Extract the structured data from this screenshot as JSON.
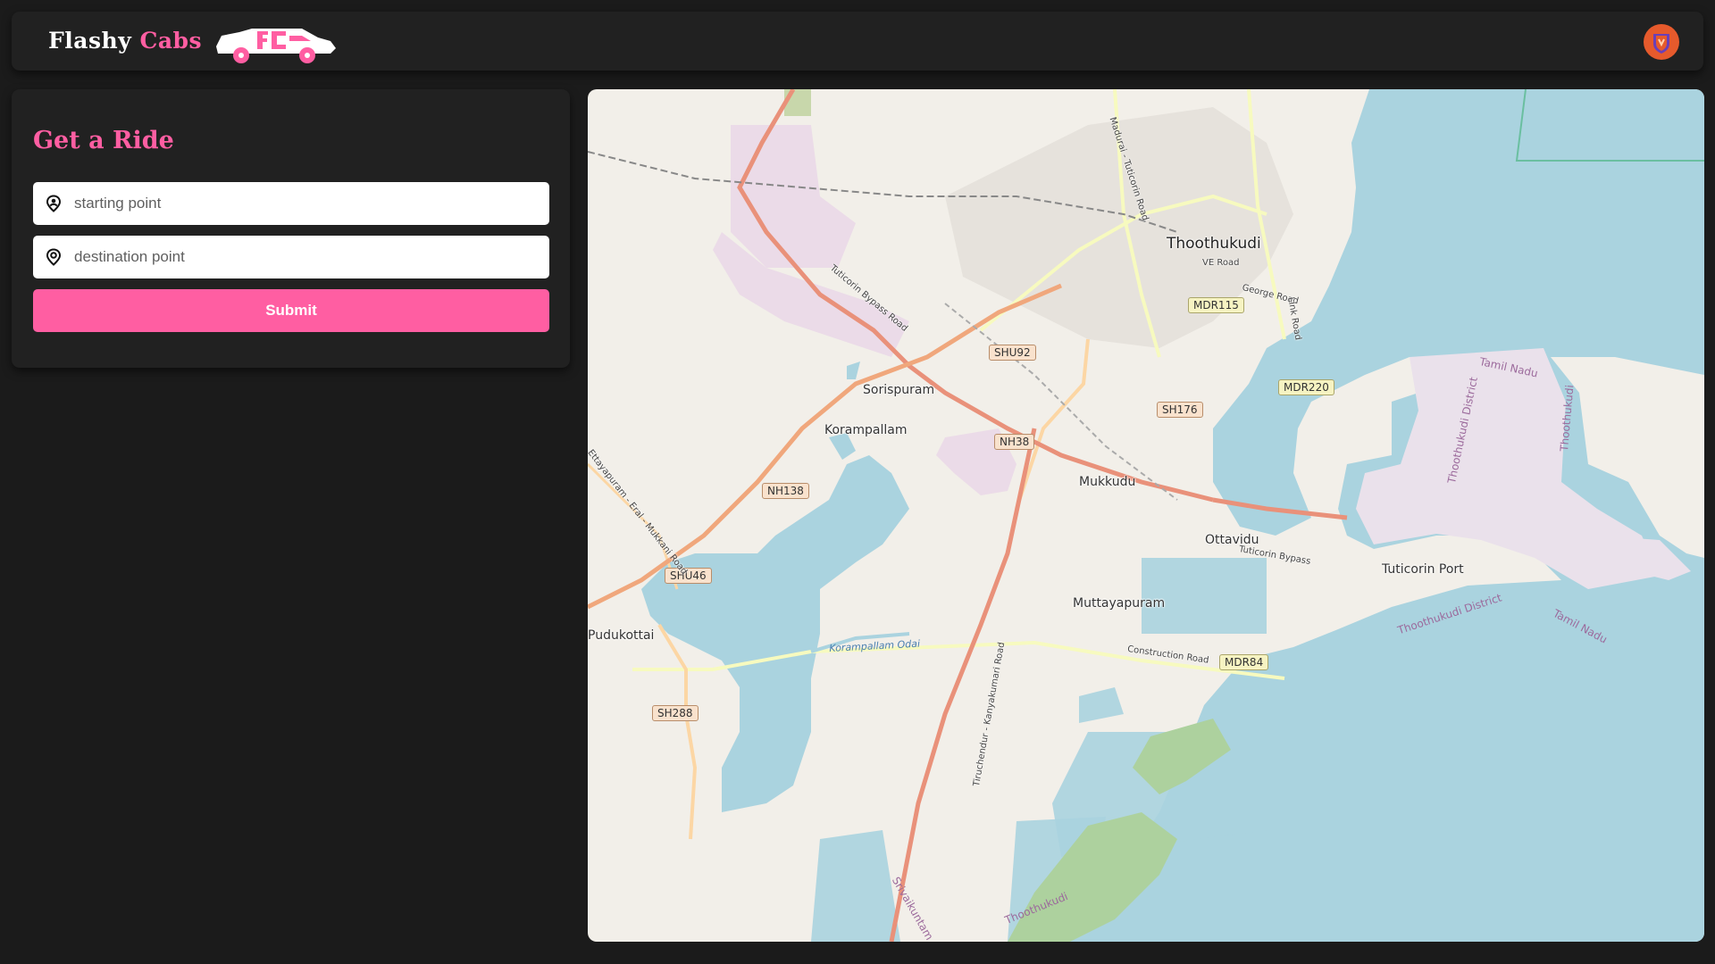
{
  "app": {
    "brand_part1": "Flashy",
    "brand_part2": "Cabs",
    "logo_icon": "car-logo-icon",
    "avatar_icon": "user-shield-icon"
  },
  "colors": {
    "accent": "#ff5ea2",
    "background": "#1b1b1b",
    "panel": "#212121",
    "avatar": "#e65a2c"
  },
  "ride_form": {
    "title": "Get a Ride",
    "start": {
      "placeholder": "starting point",
      "value": "",
      "icon": "user-pin-icon"
    },
    "destination": {
      "placeholder": "destination point",
      "value": "",
      "icon": "location-pin-icon"
    },
    "submit_label": "Submit"
  },
  "map": {
    "places": {
      "thoothukudi": "Thoothukudi",
      "sorispuram": "Sorispuram",
      "korampallam": "Korampallam",
      "mukkudu": "Mukkudu",
      "ottavidu": "Ottavidu",
      "tuticorin_port": "Tuticorin Port",
      "muttayapuram": "Muttayapuram",
      "pudukottai": "Pudukottai"
    },
    "shields": {
      "shu92": "SHU92",
      "mdr115": "MDR115",
      "mdr220": "MDR220",
      "sh176": "SH176",
      "nh38": "NH38",
      "nh138": "NH138",
      "shu46": "SHU46",
      "mdr84": "MDR84",
      "sh288": "SH288"
    },
    "roads": {
      "bypass_road": "Tuticorin Bypass Road",
      "ve_road": "VE Road",
      "george_road": "George Road",
      "link_road": "Link Road",
      "madurai_road": "Madurai - Tuticorin Road",
      "tuticorin_bypass": "Tuticorin Bypass",
      "construction_road": "Construction Road",
      "ettayapuram_road": "Ettayapuram - Eral - Mukkani Road",
      "kanyakumari_road": "Tiruchendur - Kanyakumari Road"
    },
    "water": {
      "korampallam_odai": "Korampallam Odai"
    },
    "districts": {
      "tamil_nadu_1": "Tamil Nadu",
      "tamil_nadu_2": "Tamil Nadu",
      "district_1": "Thoothukudi District",
      "district_2": "Thoothukudi District",
      "thoothukudi_v": "Thoothukudi",
      "srivaikuntam": "Srivaikuntam",
      "thoothukudi_s": "Thoothukudi"
    }
  }
}
